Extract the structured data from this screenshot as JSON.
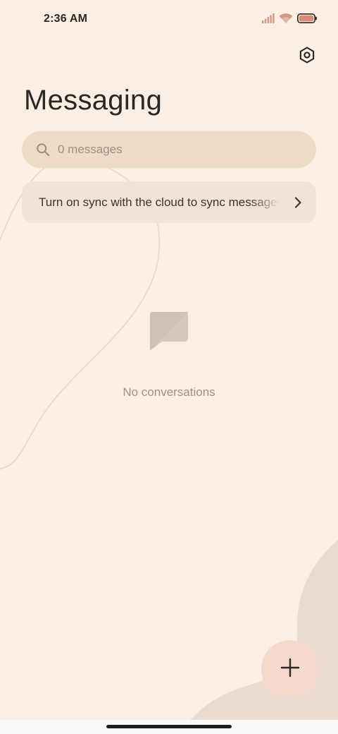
{
  "status_bar": {
    "time": "2:36 AM"
  },
  "header": {
    "title": "Messaging"
  },
  "search": {
    "placeholder": "0 messages"
  },
  "sync_banner": {
    "text": "Turn on sync with the cloud to sync messages"
  },
  "empty_state": {
    "text": "No conversations"
  },
  "icons": {
    "signal": "cellular-signal-icon",
    "wifi": "wifi-icon",
    "battery": "battery-icon",
    "settings": "gear-icon",
    "search": "search-icon",
    "chevron": "chevron-right-icon",
    "empty": "chat-bubble-icon",
    "compose": "plus-icon"
  },
  "colors": {
    "background": "#fbeee5",
    "search_fill": "#eddbc7",
    "banner_fill": "#f1e3d8",
    "fab_fill": "#f3d8cb",
    "battery_accent": "#d88c78"
  }
}
